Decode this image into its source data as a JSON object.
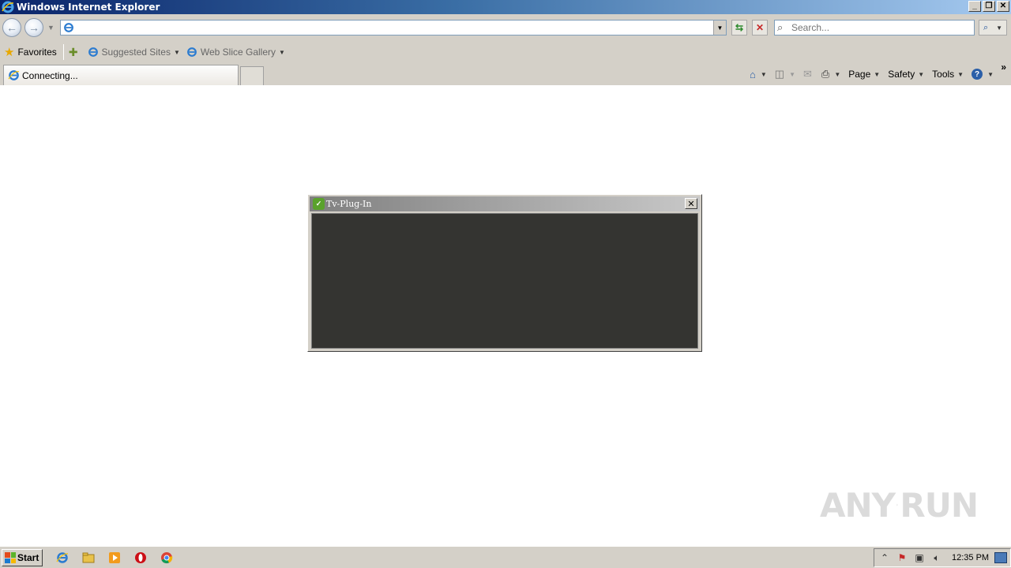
{
  "window": {
    "title": "Windows Internet Explorer",
    "controls": [
      "minimize",
      "restore",
      "close"
    ]
  },
  "address_bar": {
    "url": "",
    "search_placeholder": "Search..."
  },
  "favorites_bar": {
    "favorites_label": "Favorites",
    "links": [
      {
        "label": "Suggested Sites"
      },
      {
        "label": "Web Slice Gallery"
      }
    ]
  },
  "tabs": [
    {
      "label": "Connecting..."
    }
  ],
  "command_bar": {
    "page_label": "Page",
    "safety_label": "Safety",
    "tools_label": "Tools"
  },
  "popup": {
    "title": "Tv-Plug-In",
    "body_color": "#343431"
  },
  "watermark": {
    "left_text": "ANY",
    "right_text": "RUN"
  },
  "taskbar": {
    "start_label": "Start",
    "clock": "12:35 PM",
    "quick_launch": [
      "internet-explorer-icon",
      "folder-icon",
      "media-player-icon",
      "opera-icon",
      "chrome-icon"
    ]
  },
  "colors": {
    "titlebar_start": "#0a246a",
    "titlebar_end": "#a6caf0",
    "chrome": "#d4d0c8"
  }
}
